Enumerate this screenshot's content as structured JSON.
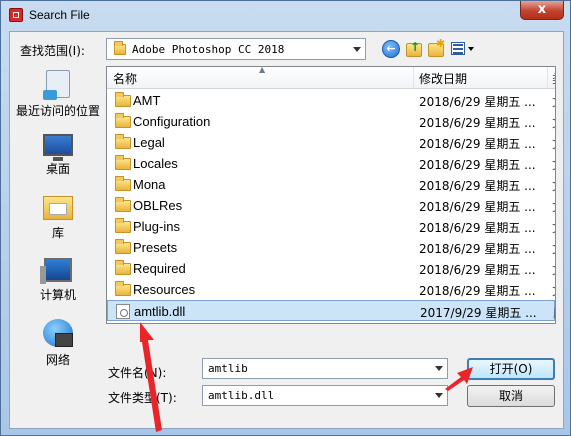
{
  "window": {
    "title": "Search File",
    "close_glyph": "x"
  },
  "toolbar": {
    "lookin_label": "查找范围(I):",
    "lookin_value": "Adobe Photoshop CC 2018",
    "back_icon": "back-icon",
    "up_icon": "up-folder-icon",
    "newfolder_icon": "new-folder-icon",
    "view_icon": "view-menu-icon"
  },
  "places": [
    {
      "label": "最近访问的位置",
      "icon": "recent-places-icon"
    },
    {
      "label": "桌面",
      "icon": "desktop-icon"
    },
    {
      "label": "库",
      "icon": "libraries-icon"
    },
    {
      "label": "计算机",
      "icon": "computer-icon"
    },
    {
      "label": "网络",
      "icon": "network-icon"
    }
  ],
  "list": {
    "columns": [
      "名称",
      "修改日期",
      "类"
    ],
    "rows": [
      {
        "name": "AMT",
        "date": "2018/6/29 星期五 ...",
        "type": "文",
        "kind": "folder"
      },
      {
        "name": "Configuration",
        "date": "2018/6/29 星期五 ...",
        "type": "文",
        "kind": "folder"
      },
      {
        "name": "Legal",
        "date": "2018/6/29 星期五 ...",
        "type": "文",
        "kind": "folder"
      },
      {
        "name": "Locales",
        "date": "2018/6/29 星期五 ...",
        "type": "文",
        "kind": "folder"
      },
      {
        "name": "Mona",
        "date": "2018/6/29 星期五 ...",
        "type": "文",
        "kind": "folder"
      },
      {
        "name": "OBLRes",
        "date": "2018/6/29 星期五 ...",
        "type": "文",
        "kind": "folder"
      },
      {
        "name": "Plug-ins",
        "date": "2018/6/29 星期五 ...",
        "type": "文",
        "kind": "folder"
      },
      {
        "name": "Presets",
        "date": "2018/6/29 星期五 ...",
        "type": "文",
        "kind": "folder"
      },
      {
        "name": "Required",
        "date": "2018/6/29 星期五 ...",
        "type": "文",
        "kind": "folder"
      },
      {
        "name": "Resources",
        "date": "2018/6/29 星期五 ...",
        "type": "文",
        "kind": "folder"
      },
      {
        "name": "amtlib.dll",
        "date": "2017/9/29 星期五 ...",
        "type": "应",
        "kind": "dll",
        "selected": true
      }
    ]
  },
  "form": {
    "filename_label": "文件名(N):",
    "filename_value": "amtlib",
    "filetype_label": "文件类型(T):",
    "filetype_value": "amtlib.dll",
    "open_label": "打开(O)",
    "cancel_label": "取消"
  },
  "colors": {
    "annotation_arrow": "#e8262a",
    "selection": "#cce4f7"
  }
}
